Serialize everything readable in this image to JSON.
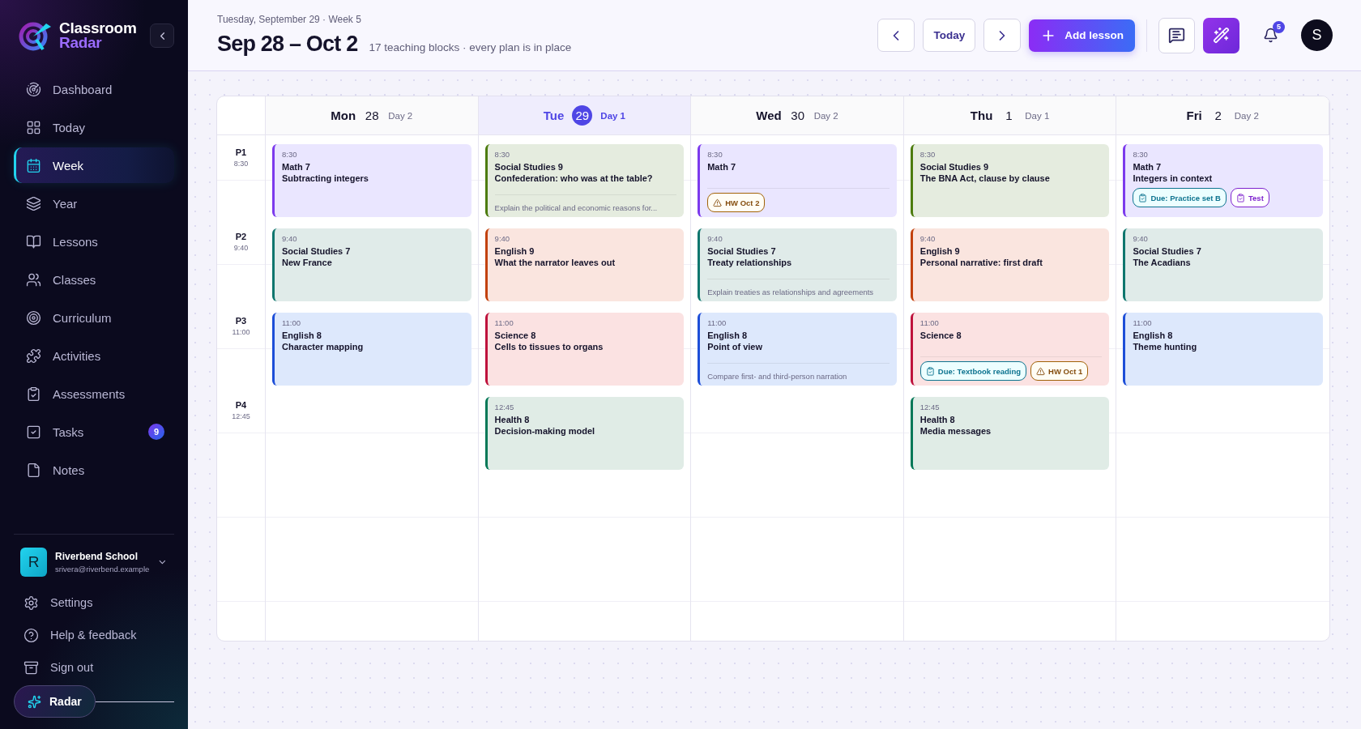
{
  "sidebar": {
    "brand": {
      "line1": "Classroom",
      "line2": "Radar"
    },
    "nav": [
      {
        "label": "Dashboard",
        "selected": false
      },
      {
        "label": "Today",
        "selected": false
      },
      {
        "label": "Week",
        "selected": true
      },
      {
        "label": "Year",
        "selected": false
      },
      {
        "label": "Lessons",
        "selected": false
      },
      {
        "label": "Classes",
        "selected": false
      },
      {
        "label": "Curriculum",
        "selected": false
      },
      {
        "label": "Activities",
        "selected": false
      },
      {
        "label": "Assessments",
        "selected": false
      },
      {
        "label": "Tasks",
        "selected": false,
        "badge": "9"
      },
      {
        "label": "Notes",
        "selected": false
      }
    ],
    "account": {
      "initial": "R",
      "name": "Riverbend School",
      "email": "srivera@riverbend.example"
    },
    "footer_links": [
      {
        "label": "Settings"
      },
      {
        "label": "Help & feedback"
      },
      {
        "label": "Sign out"
      }
    ],
    "assistant": {
      "label": "Radar"
    }
  },
  "header": {
    "date_line": "Tuesday, September 29 · Week 5",
    "range": "Sep 28 – Oct 2",
    "summary": "17 teaching blocks · every plan is in place",
    "today_button": "Today",
    "add_button": "Add lesson",
    "notification_count": "5",
    "avatar_initial": "S"
  },
  "calendar": {
    "periods": [
      {
        "label": "P1",
        "time": "8:30"
      },
      {
        "label": "P2",
        "time": "9:40"
      },
      {
        "label": "P3",
        "time": "11:00"
      },
      {
        "label": "P4",
        "time": "12:45"
      }
    ],
    "days": [
      {
        "weekday": "Mon",
        "date": "28",
        "cycle_day": "Day 2",
        "selected": false,
        "lessons": [
          {
            "time": "8:30",
            "course": "Math 7",
            "title": "Subtracting integers",
            "color": "#7c3aed"
          },
          {
            "time": "9:40",
            "course": "Social Studies 7",
            "title": "New France",
            "color": "#0f766e"
          },
          {
            "time": "11:00",
            "course": "English 8",
            "title": "Character mapping",
            "color": "#1d4ed8"
          }
        ]
      },
      {
        "weekday": "Tue",
        "date": "29",
        "cycle_day": "Day 1",
        "selected": true,
        "lessons": [
          {
            "time": "8:30",
            "course": "Social Studies 9",
            "title": "Confederation: who was at the table?",
            "note": "Explain the political and economic reasons for...",
            "color": "#4d7c0f"
          },
          {
            "time": "9:40",
            "course": "English 9",
            "title": "What the narrator leaves out",
            "color": "#c2410c"
          },
          {
            "time": "11:00",
            "course": "Science 8",
            "title": "Cells to tissues to organs",
            "color": "#be123c"
          },
          {
            "time": "12:45",
            "course": "Health 8",
            "title": "Decision-making model",
            "color": "#047857"
          }
        ]
      },
      {
        "weekday": "Wed",
        "date": "30",
        "cycle_day": "Day 2",
        "selected": false,
        "lessons": [
          {
            "time": "8:30",
            "course": "Math 7",
            "color": "#7c3aed",
            "tags": [
              {
                "kind": "hw",
                "label": "HW Oct 2"
              }
            ]
          },
          {
            "time": "9:40",
            "course": "Social Studies 7",
            "title": "Treaty relationships",
            "note": "Explain treaties as relationships and agreements",
            "color": "#0f766e"
          },
          {
            "time": "11:00",
            "course": "English 8",
            "title": "Point of view",
            "note": "Compare first- and third-person narration",
            "color": "#1d4ed8"
          }
        ]
      },
      {
        "weekday": "Thu",
        "date": "1",
        "cycle_day": "Day 1",
        "selected": false,
        "lessons": [
          {
            "time": "8:30",
            "course": "Social Studies 9",
            "title": "The BNA Act, clause by clause",
            "color": "#4d7c0f"
          },
          {
            "time": "9:40",
            "course": "English 9",
            "title": "Personal narrative: first draft",
            "color": "#c2410c"
          },
          {
            "time": "11:00",
            "course": "Science 8",
            "color": "#be123c",
            "tags": [
              {
                "kind": "due",
                "label": "Due: Textbook reading"
              },
              {
                "kind": "hw",
                "label": "HW Oct 1"
              }
            ]
          },
          {
            "time": "12:45",
            "course": "Health 8",
            "title": "Media messages",
            "color": "#047857"
          }
        ]
      },
      {
        "weekday": "Fri",
        "date": "2",
        "cycle_day": "Day 2",
        "selected": false,
        "lessons": [
          {
            "time": "8:30",
            "course": "Math 7",
            "title": "Integers in context",
            "color": "#7c3aed",
            "tags": [
              {
                "kind": "due",
                "label": "Due: Practice set B"
              },
              {
                "kind": "test",
                "label": "Test"
              }
            ]
          },
          {
            "time": "9:40",
            "course": "Social Studies 7",
            "title": "The Acadians",
            "color": "#0f766e"
          },
          {
            "time": "11:00",
            "course": "English 8",
            "title": "Theme hunting",
            "color": "#1d4ed8"
          }
        ]
      }
    ]
  }
}
